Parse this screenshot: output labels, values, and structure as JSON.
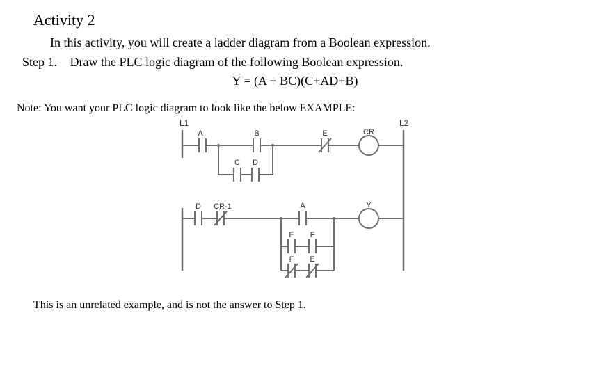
{
  "title": "Activity 2",
  "intro": "In this activity, you will create a ladder diagram from a Boolean expression.",
  "step_label": "Step 1.",
  "step_text": "Draw the PLC logic diagram of the following Boolean expression.",
  "expression": "Y = (A + BC)(C+AD+B)",
  "note": "Note: You want your PLC logic diagram to look like the below EXAMPLE:",
  "footnote": "This is an unrelated example, and is not the answer to Step 1.",
  "diagram": {
    "rails": {
      "left": "L1",
      "right": "L2"
    },
    "rung1": {
      "top": {
        "c1": "A",
        "c2": "B",
        "c3": "E",
        "coil": "CR"
      },
      "par": {
        "c1": "C",
        "c2": "D"
      }
    },
    "rung2": {
      "left": {
        "c1": "D",
        "c2": "CR-1"
      },
      "mid_top": "A",
      "par1": {
        "c1": "E",
        "c2": "F"
      },
      "par2": {
        "c1": "F",
        "c2": "E"
      },
      "coil": "Y"
    }
  }
}
